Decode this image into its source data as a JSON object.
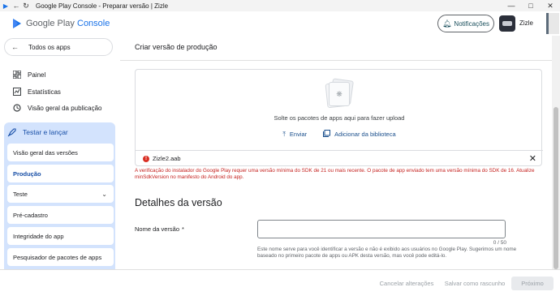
{
  "window": {
    "title": "Google Play Console - Preparar versão | Zizle",
    "minimize_icon": "—",
    "maximize_icon": "□",
    "close_icon": "✕"
  },
  "appbar": {
    "brand_google_play": "Google Play",
    "brand_console": "Console",
    "notifications_label": "Notificações",
    "account_name": "Zizle"
  },
  "sidebar": {
    "back_label": "Todos os apps",
    "items": [
      {
        "label": "Painel",
        "icon": "dashboard-icon"
      },
      {
        "label": "Estatísticas",
        "icon": "statistics-icon"
      },
      {
        "label": "Visão geral da publicação",
        "icon": "publishing-overview-icon"
      }
    ],
    "group": {
      "label": "Testar e lançar",
      "icon": "rocket-icon",
      "items": [
        {
          "label": "Visão geral das versões",
          "active": false
        },
        {
          "label": "Produção",
          "active": true
        },
        {
          "label": "Teste",
          "active": false,
          "expandable": true
        },
        {
          "label": "Pré-cadastro",
          "active": false
        },
        {
          "label": "Integridade do app",
          "active": false
        },
        {
          "label": "Pesquisador de pacotes de apps",
          "active": false
        }
      ]
    }
  },
  "main": {
    "page_title": "Criar versão de produção",
    "upload": {
      "drop_text": "Solte os pacotes de apps aqui para fazer upload",
      "send_label": "Enviar",
      "library_label": "Adicionar da biblioteca",
      "file_name": "Zizle2.aab"
    },
    "error_message": "A verificação do instalador do Google Play requer uma versão mínima do SDK de 21 ou mais recente. O pacote de app enviado tem uma versão mínima do SDK de 16. Atualize minSdkVersion no manifesto do Android do app.",
    "details_title": "Detalhes da versão",
    "release_name": {
      "label": "Nome da versão",
      "required_mark": "*",
      "value": "",
      "counter": "0 / 50",
      "helper": "Este nome serve para você identificar a versão e não é exibido aos usuários no Google Play. Sugerimos um nome baseado no primeiro pacote de apps ou APK desta versão, mas você pode editá-lo."
    }
  },
  "footer": {
    "cancel_label": "Cancelar alterações",
    "save_draft_label": "Salvar como rascunho",
    "next_label": "Próximo"
  },
  "colors": {
    "accent": "#1a73e8",
    "nav_active_bg": "#d3e3fd",
    "nav_active_text": "#174ea6",
    "error": "#c5221f"
  }
}
